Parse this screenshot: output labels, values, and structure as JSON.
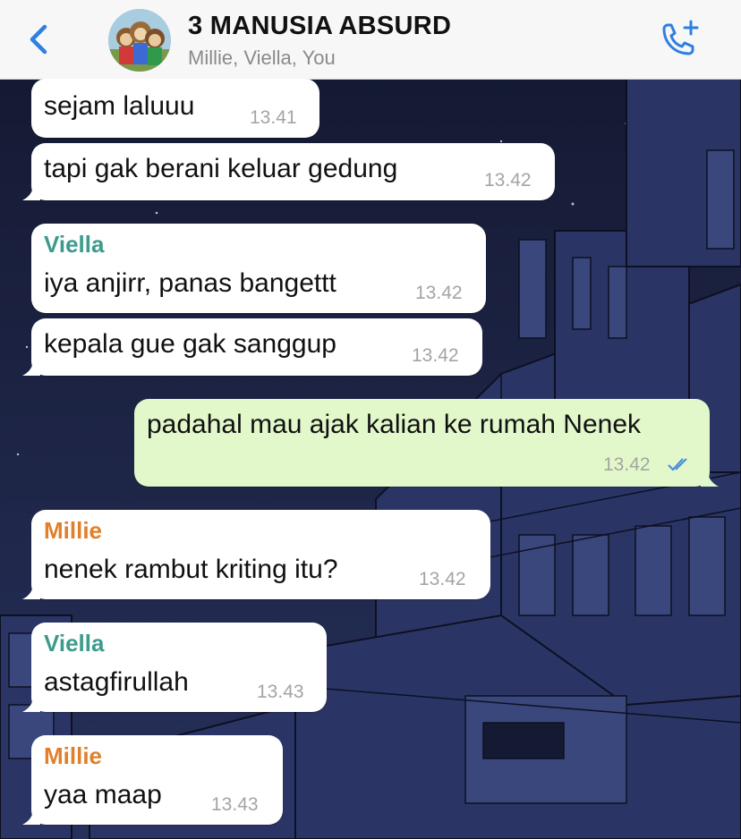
{
  "header": {
    "back_icon": "chevron-left-icon",
    "title": "3 MANUSIA ABSURD",
    "subtitle": "Millie, Viella, You",
    "call_icon": "phone-add-icon",
    "accent_color": "#2f7fe0"
  },
  "messages": [
    {
      "direction": "in",
      "sender": "",
      "text": "sejam laluuu",
      "time": "13.41"
    },
    {
      "direction": "in",
      "sender": "",
      "text": "tapi gak berani keluar gedung",
      "time": "13.42"
    },
    {
      "direction": "in",
      "sender": "Viella",
      "sender_color": "#3c9b8c",
      "text": "iya anjirr, panas bangettt",
      "time": "13.42"
    },
    {
      "direction": "in",
      "sender": "",
      "text": "kepala gue gak sanggup",
      "time": "13.42"
    },
    {
      "direction": "out",
      "sender": "",
      "text": "padahal mau ajak kalian ke rumah Nenek",
      "time": "13.42",
      "status": "read"
    },
    {
      "direction": "in",
      "sender": "Millie",
      "sender_color": "#e0802a",
      "text": "nenek rambut kriting itu?",
      "time": "13.42"
    },
    {
      "direction": "in",
      "sender": "Viella",
      "sender_color": "#3c9b8c",
      "text": "astagfirullah",
      "time": "13.43"
    },
    {
      "direction": "in",
      "sender": "Millie",
      "sender_color": "#e0802a",
      "text": "yaa maap",
      "time": "13.43"
    }
  ]
}
